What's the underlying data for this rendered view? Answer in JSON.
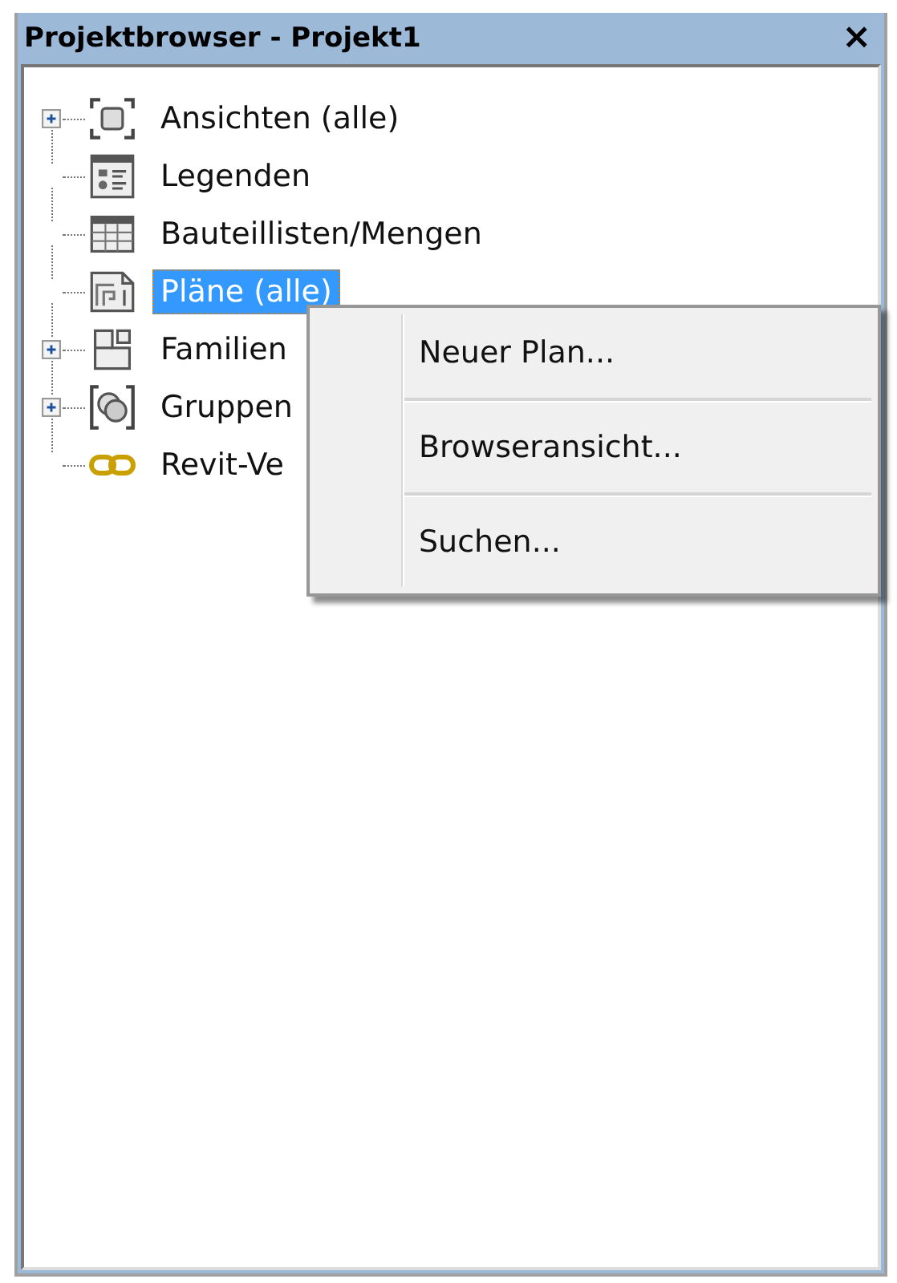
{
  "window": {
    "title": "Projektbrowser - Projekt1",
    "close": "×"
  },
  "tree": [
    {
      "label": "Ansichten (alle)",
      "kind": "view",
      "collapsed": true,
      "selected": false
    },
    {
      "label": "Legenden",
      "kind": "legend",
      "collapsed": false,
      "selected": false
    },
    {
      "label": "Bauteillisten/Mengen",
      "kind": "schedule",
      "collapsed": false,
      "selected": false
    },
    {
      "label": "Pläne (alle)",
      "kind": "sheet",
      "collapsed": false,
      "selected": true
    },
    {
      "label": "Familien",
      "kind": "family",
      "collapsed": true,
      "selected": false
    },
    {
      "label": "Gruppen",
      "kind": "group",
      "collapsed": true,
      "selected": false
    },
    {
      "label": "Revit-Ve",
      "kind": "link",
      "collapsed": false,
      "selected": false
    }
  ],
  "context_menu": {
    "items": [
      "Neuer Plan...",
      "Browseransicht...",
      "Suchen..."
    ]
  }
}
